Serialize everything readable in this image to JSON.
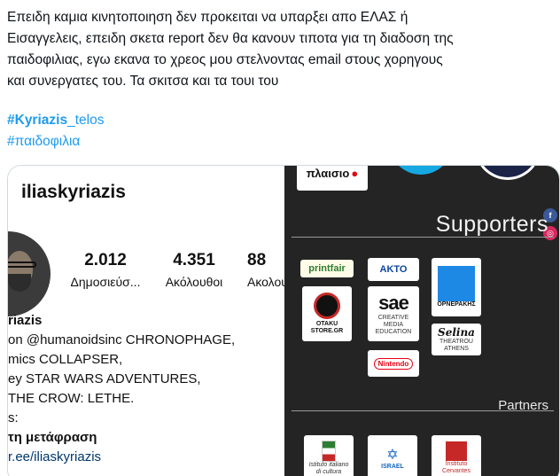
{
  "tweet": {
    "lines": [
      "Επειδη καμια κινητοποιηση δεν προκειται να υπαρξει απο ΕΛΑΣ ή",
      "Εισαγγελεις, επειδη σκετα report δεν θα κανουν τιποτα για τη διαδοση της",
      "παιδοφιλιας, εγω εκανα το χρεος μου στελνοντας email στους χορηγους",
      "και συνεργατες του. Τα σκιτσα και τα τουι του"
    ],
    "hashtag1_bold": "#Kyriazis",
    "hashtag1_rest": "_telos",
    "hashtag2": "#παιδοφιλια"
  },
  "instagram": {
    "username": "iliaskyriazis",
    "stats": [
      {
        "num": "2.012",
        "label": "Δημοσιεύσ..."
      },
      {
        "num": "4.351",
        "label": "Ακόλουθοι"
      },
      {
        "num": "88",
        "label": "Ακολουθεί"
      }
    ],
    "bio": {
      "name": "riazis",
      "line1": "on @humanoidsinc CHRONOPHAGE,",
      "line2": "mics COLLAPSER,",
      "line3": "ey STAR WARS ADVENTURES,",
      "line4": "THE CROW: LETHE.",
      "line5": "s:",
      "translate": "τη μετάφραση",
      "link": "r.ee/iliaskyriazis"
    }
  },
  "supporters": {
    "heading": "Supporters",
    "partners": "Partners",
    "logos": {
      "plaisio": "πλαισιο",
      "printfair": "printfair",
      "akto": "ΑΚΤΟ",
      "ornerakis": "ΟΡΝΕΡΑΚΗΣ",
      "otaku": "OTAKU STORE.GR",
      "sae": "sae",
      "sae_sub": "CREATIVE MEDIA EDUCATION",
      "selina": "Selina",
      "selina_sub": "THEATROU ATHENS",
      "nintendo": "Nintendo",
      "istituto": "Istituto italiano di cultura",
      "israel": "ISRAEL",
      "cervantes": "Instituto Cervantes"
    },
    "social": {
      "facebook": "f",
      "instagram": "◎"
    }
  },
  "colors": {
    "accent": "#1d9bf0",
    "dark_bg": "#242424"
  }
}
